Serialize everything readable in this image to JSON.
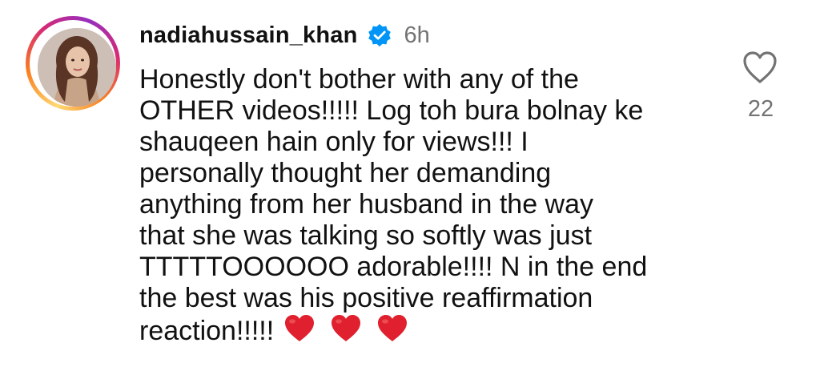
{
  "comment": {
    "username": "nadiahussain_khan",
    "verified_icon": "verified-badge-icon",
    "time": "6h",
    "text_lines": [
      "Honestly don't bother with any of the",
      "OTHER videos!!!!! Log toh bura bolnay ke",
      "shauqeen hain only for views!!! I",
      "personally thought her demanding",
      "anything from her husband in the way",
      "that she was talking so softly was just",
      "TTTTTOOOOOO adorable!!!! N in the end",
      "the best was his positive reaffirmation",
      "reaction!!!!!"
    ],
    "emojis": [
      "❤️",
      "❤️",
      "❤️"
    ],
    "like_icon": "heart-outline-icon",
    "like_count": "22"
  },
  "colors": {
    "text": "#111111",
    "secondary": "#737373",
    "verified": "#0095f6",
    "heart_emoji": "#e0202e"
  }
}
